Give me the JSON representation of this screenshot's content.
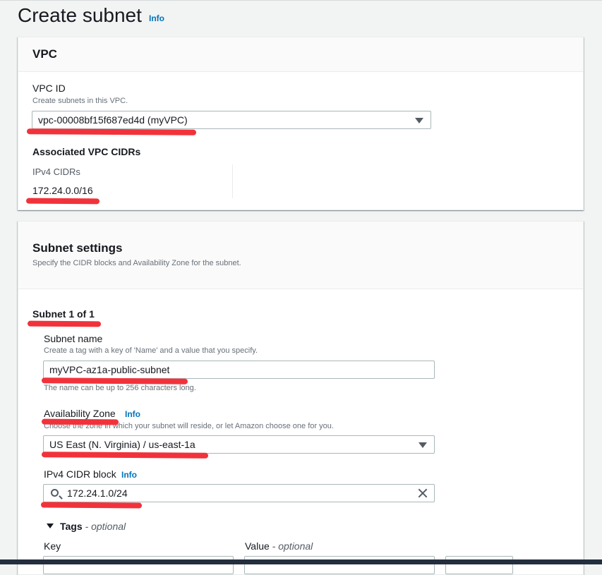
{
  "page": {
    "title": "Create subnet",
    "info": "Info"
  },
  "vpc_panel": {
    "title": "VPC",
    "vpc_id_label": "VPC ID",
    "vpc_id_desc": "Create subnets in this VPC.",
    "vpc_id_value": "vpc-00008bf15f687ed4d (myVPC)",
    "assoc_title": "Associated VPC CIDRs",
    "ipv4_cidrs_label": "IPv4 CIDRs",
    "ipv4_cidr_value": "172.24.0.0/16"
  },
  "subnet_panel": {
    "title": "Subnet settings",
    "desc": "Specify the CIDR blocks and Availability Zone for the subnet.",
    "subnet_count": "Subnet 1 of 1",
    "name_label": "Subnet name",
    "name_desc": "Create a tag with a key of 'Name' and a value that you specify.",
    "name_value": "myVPC-az1a-public-subnet",
    "name_hint": "The name can be up to 256 characters long.",
    "az_label": "Availability Zone",
    "az_info": "Info",
    "az_desc": "Choose the zone in which your subnet will reside, or let Amazon choose one for you.",
    "az_value": "US East (N. Virginia) / us-east-1a",
    "cidr_label": "IPv4 CIDR block",
    "cidr_info": "Info",
    "cidr_value": "172.24.1.0/24",
    "tags_label": "Tags",
    "tags_optional": "optional",
    "key_label": "Key",
    "value_label": "Value",
    "value_optional": "optional"
  },
  "colors": {
    "accent": "#0073bb",
    "redline": "#f2323b"
  }
}
